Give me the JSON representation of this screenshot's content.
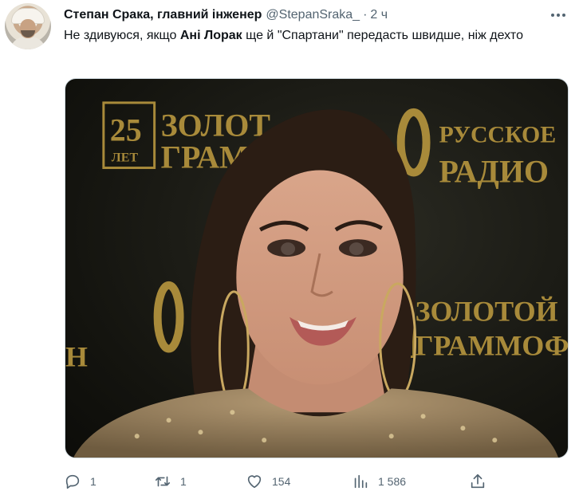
{
  "tweet": {
    "author_name": "Степан Срака, главний інженер",
    "author_handle": "@StepanSraka_",
    "separator": "·",
    "time": "2 ч",
    "text_before": "Не здивуюся, якщо ",
    "text_bold": "Ані Лорак",
    "text_after": " ще й \"Спартани\" передасть швидше, ніж дехто",
    "media": {
      "backdrop_texts": [
        "25",
        "ЛЕТ",
        "ЗОЛОТ",
        "ГРАМ",
        "РУССКОЕ",
        "РАДИО",
        "ЗОЛОТОЙ",
        "ГРАММОФОН",
        "Н"
      ]
    }
  },
  "actions": {
    "reply": {
      "icon": "reply-icon",
      "count": "1"
    },
    "retweet": {
      "icon": "retweet-icon",
      "count": "1"
    },
    "like": {
      "icon": "heart-icon",
      "count": "154"
    },
    "views": {
      "icon": "views-icon",
      "count": "1 586"
    },
    "share": {
      "icon": "share-icon"
    }
  },
  "colors": {
    "text": "#0f1419",
    "secondary": "#536471",
    "gold": "#b8973f"
  }
}
